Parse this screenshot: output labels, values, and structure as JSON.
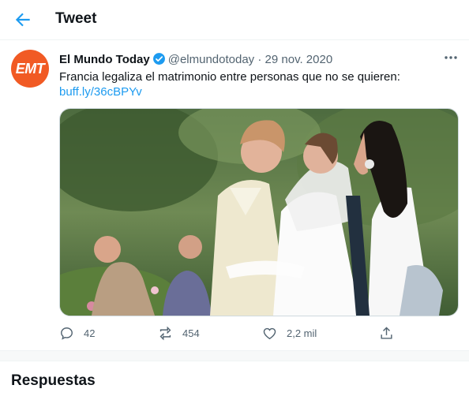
{
  "header": {
    "title": "Tweet",
    "back_icon": "arrow-left-icon",
    "accent": "#1d9bf0"
  },
  "tweet": {
    "avatar_text": "EMT",
    "avatar_color": "#f15a24",
    "author_name": "El Mundo Today",
    "handle": "@elmundotoday",
    "separator": "·",
    "date": "29 nov. 2020",
    "text": "Francia legaliza el matrimonio entre personas que no se quieren:",
    "link": "buff.ly/36cBPYv",
    "more_icon": "more-horizontal-icon"
  },
  "actions": {
    "replies": "42",
    "retweets": "454",
    "likes": "2,2 mil"
  },
  "replies_section": {
    "title": "Respuestas"
  }
}
